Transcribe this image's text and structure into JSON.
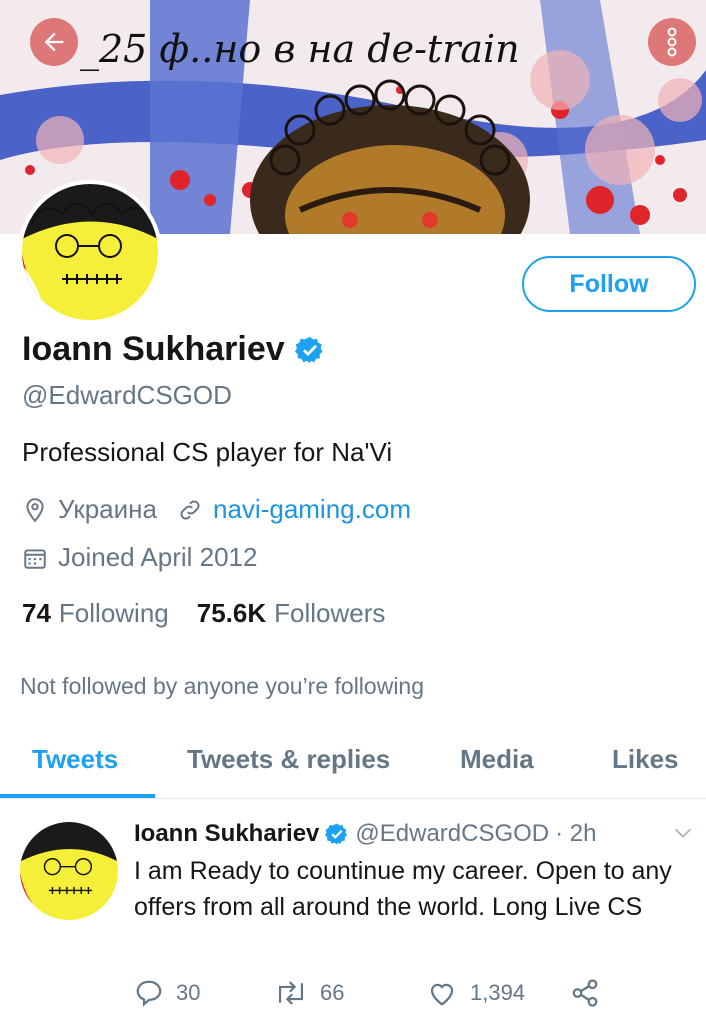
{
  "banner": {
    "scrawl_text": "_25 ф..но в на de-train"
  },
  "header": {
    "follow_label": "Follow"
  },
  "profile": {
    "name": "Ioann Sukhariev",
    "handle": "@EdwardCSGOD",
    "bio": "Professional CS player for Na'Vi",
    "location": "Украина",
    "website": "navi-gaming.com",
    "joined": "Joined April 2012",
    "following_count": "74",
    "following_label": "Following",
    "followers_count": "75.6K",
    "followers_label": "Followers",
    "not_followed": "Not followed by anyone you’re following"
  },
  "tabs": [
    {
      "label": "Tweets",
      "active": true
    },
    {
      "label": "Tweets & replies",
      "active": false
    },
    {
      "label": "Media",
      "active": false
    },
    {
      "label": "Likes",
      "active": false
    }
  ],
  "tweet": {
    "name": "Ioann Sukhariev",
    "handle": "@EdwardCSGOD",
    "time": "· 2h",
    "text": "I am Ready to countinue my career. Open to any offers from all around the world. Long Live CS",
    "replies": "30",
    "retweets": "66",
    "likes": "1,394"
  },
  "icons": {
    "back": "arrow-left-icon",
    "more": "more-vertical-icon",
    "verified": "verified-badge-icon",
    "location": "location-pin-icon",
    "link": "link-icon",
    "calendar": "calendar-icon",
    "chevron": "chevron-down-icon",
    "reply": "reply-icon",
    "retweet": "retweet-icon",
    "like": "heart-icon",
    "share": "share-icon"
  },
  "colors": {
    "accent": "#1da1f2",
    "text": "#14171a",
    "secondary": "#657786",
    "header_button": "#dc6e6e",
    "banner_stripe": "#4b63c8"
  }
}
